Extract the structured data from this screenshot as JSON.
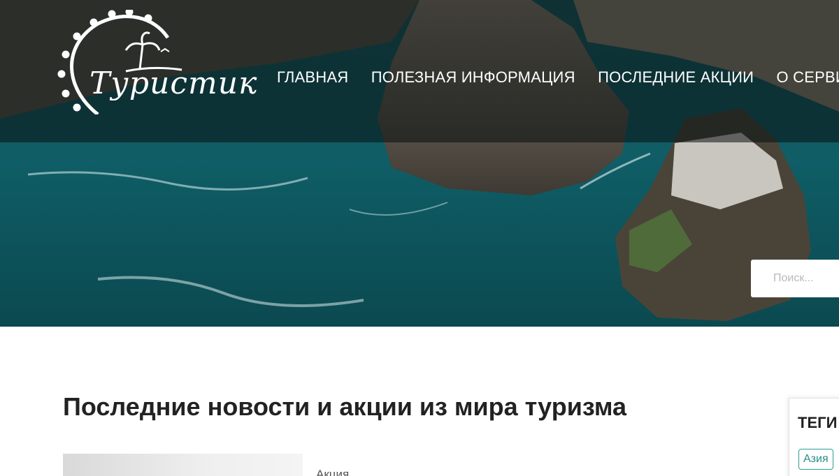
{
  "logo": {
    "text": "Туристик"
  },
  "nav": {
    "items": [
      {
        "label": "ГЛАВНАЯ"
      },
      {
        "label": "ПОЛЕЗНАЯ ИНФОРМАЦИЯ"
      },
      {
        "label": "ПОСЛЕДНИЕ АКЦИИ"
      },
      {
        "label": "О СЕРВИСЕ"
      }
    ]
  },
  "search": {
    "placeholder": "Поиск..."
  },
  "main": {
    "heading": "Последние новости и акции из мира туризма",
    "articles": [
      {
        "category": "Акция"
      }
    ]
  },
  "sidebar": {
    "title": "ТЕГИ",
    "tags": [
      {
        "label": "Азия"
      }
    ]
  },
  "colors": {
    "accent": "#2a9d96",
    "header_overlay": "#081010",
    "sea": "#13606b"
  }
}
